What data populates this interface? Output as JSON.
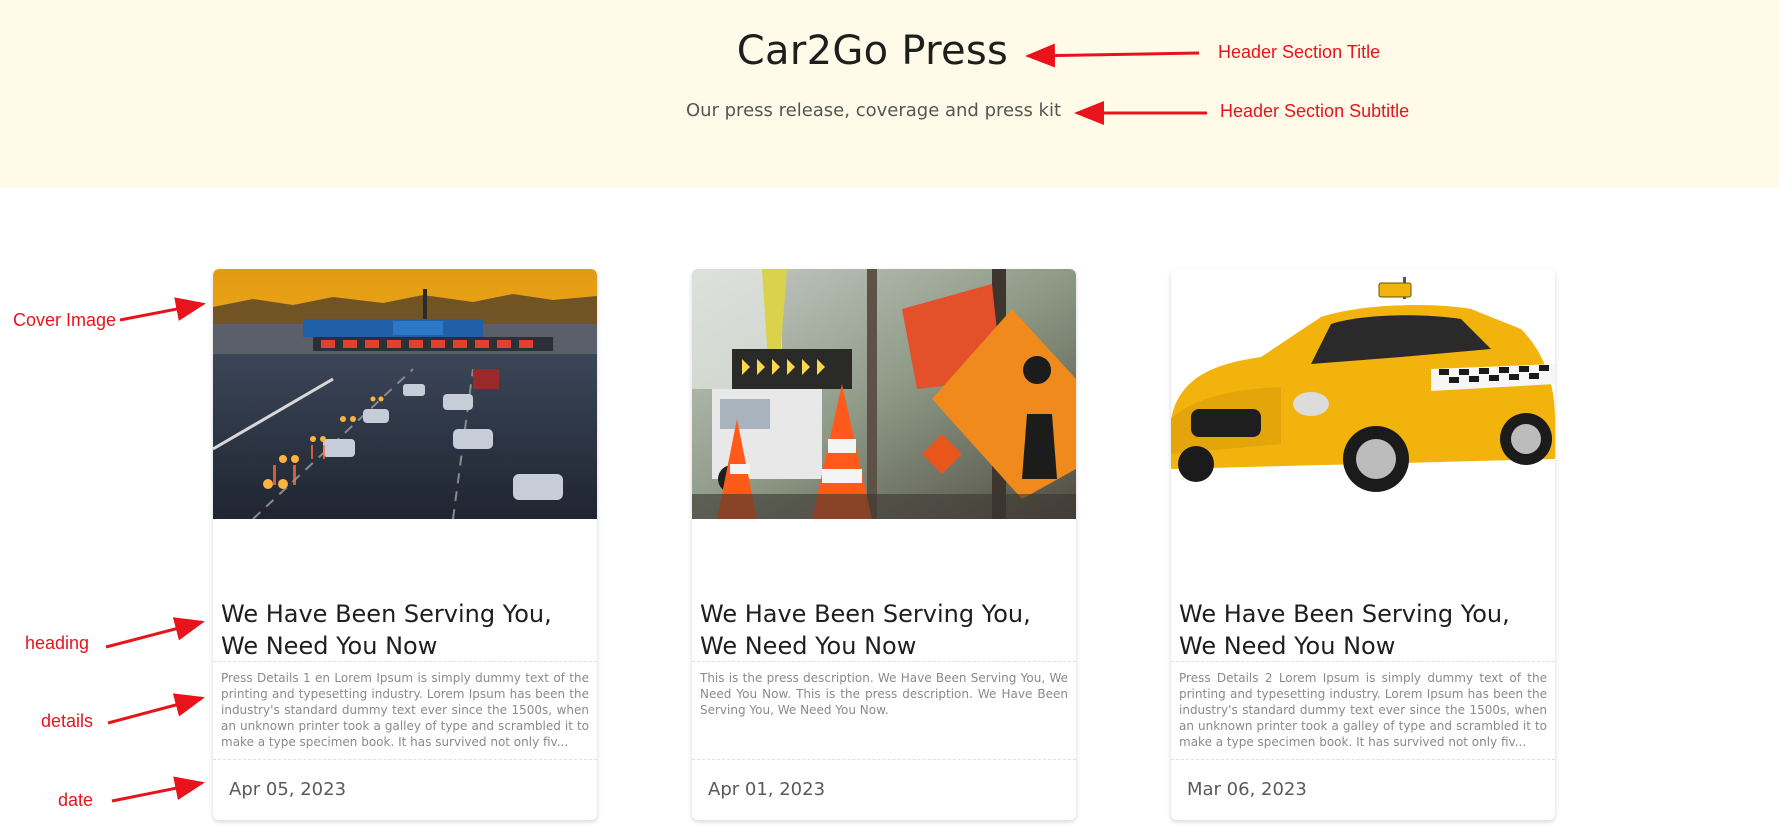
{
  "header": {
    "title": "Car2Go Press",
    "subtitle": "Our press release, coverage and press kit"
  },
  "cards": [
    {
      "image_icon": "highway-traffic-photo-icon",
      "heading": "We Have Been Serving You, We Need You Now",
      "details": "Press Details 1 en Lorem Ipsum is simply dummy text of the printing and typesetting industry. Lorem Ipsum has been the industry's standard dummy text ever since the 1500s, when an unknown printer took a galley of type and scrambled it to make a type specimen book. It has survived not only fiv...",
      "date": "Apr 05, 2023"
    },
    {
      "image_icon": "road-construction-photo-icon",
      "heading": "We Have Been Serving You, We Need You Now",
      "details": "This is the press description. We Have Been Serving You, We Need You Now. This is the press description. We Have Been Serving You, We Need You Now.",
      "date": "Apr 01, 2023"
    },
    {
      "image_icon": "yellow-taxi-photo-icon",
      "heading": "We Have Been Serving You, We Need You Now",
      "details": "Press Details 2 Lorem Ipsum is simply dummy text of the printing and typesetting industry. Lorem Ipsum has been the industry's standard dummy text ever since the 1500s, when an unknown printer took a galley of type and scrambled it to make a type specimen book. It has survived not only fiv...",
      "date": "Mar 06, 2023"
    }
  ],
  "annotations": {
    "header_title": "Header Section Title",
    "header_subtitle": "Header Section Subtitle",
    "cover_image": "Cover Image",
    "heading": "heading",
    "details": "details",
    "date": "date"
  },
  "colors": {
    "header_background": "#fffbe8",
    "annotation_red": "#e8131b",
    "title_text": "#1e1e1e",
    "details_text": "#8a8a8a"
  }
}
